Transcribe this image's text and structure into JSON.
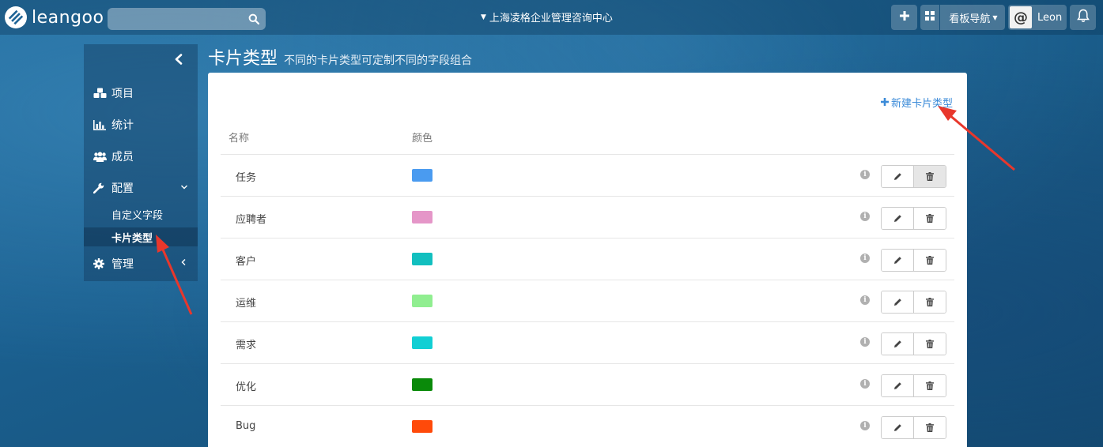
{
  "header": {
    "logo_text": "leangoo",
    "search": {
      "placeholder": ""
    },
    "org_name": "上海凌格企业管理咨询中心",
    "nav_label": "看板导航",
    "user_name": "Leon",
    "icons": [
      "logo-icon",
      "search-icon",
      "plus-icon",
      "grid-icon",
      "avatar-icon",
      "bell-icon"
    ]
  },
  "sidebar": {
    "items": [
      {
        "label": "项目",
        "icon": "cubes-icon"
      },
      {
        "label": "统计",
        "icon": "bar-chart-icon"
      },
      {
        "label": "成员",
        "icon": "users-icon"
      },
      {
        "label": "配置",
        "icon": "wrench-icon"
      },
      {
        "label": "管理",
        "icon": "gear-icon"
      }
    ],
    "config_children": [
      {
        "label": "自定义字段"
      },
      {
        "label": "卡片类型",
        "active": true
      }
    ]
  },
  "page": {
    "title": "卡片类型",
    "subtitle": "不同的卡片类型可定制不同的字段组合",
    "new_button": "新建卡片类型"
  },
  "table": {
    "columns": [
      "名称",
      "颜色"
    ],
    "rows": [
      {
        "name": "任务",
        "color": "#4a9bf0"
      },
      {
        "name": "应聘者",
        "color": "#e596c8"
      },
      {
        "name": "客户",
        "color": "#12bfbf"
      },
      {
        "name": "运维",
        "color": "#90ee90"
      },
      {
        "name": "需求",
        "color": "#12cfd4"
      },
      {
        "name": "优化",
        "color": "#0a8a0a"
      },
      {
        "name": "Bug",
        "color": "#ff4a0a"
      }
    ]
  },
  "colors": {
    "accent_link": "#3a8ad8",
    "annotation_arrow": "#e8372c"
  }
}
